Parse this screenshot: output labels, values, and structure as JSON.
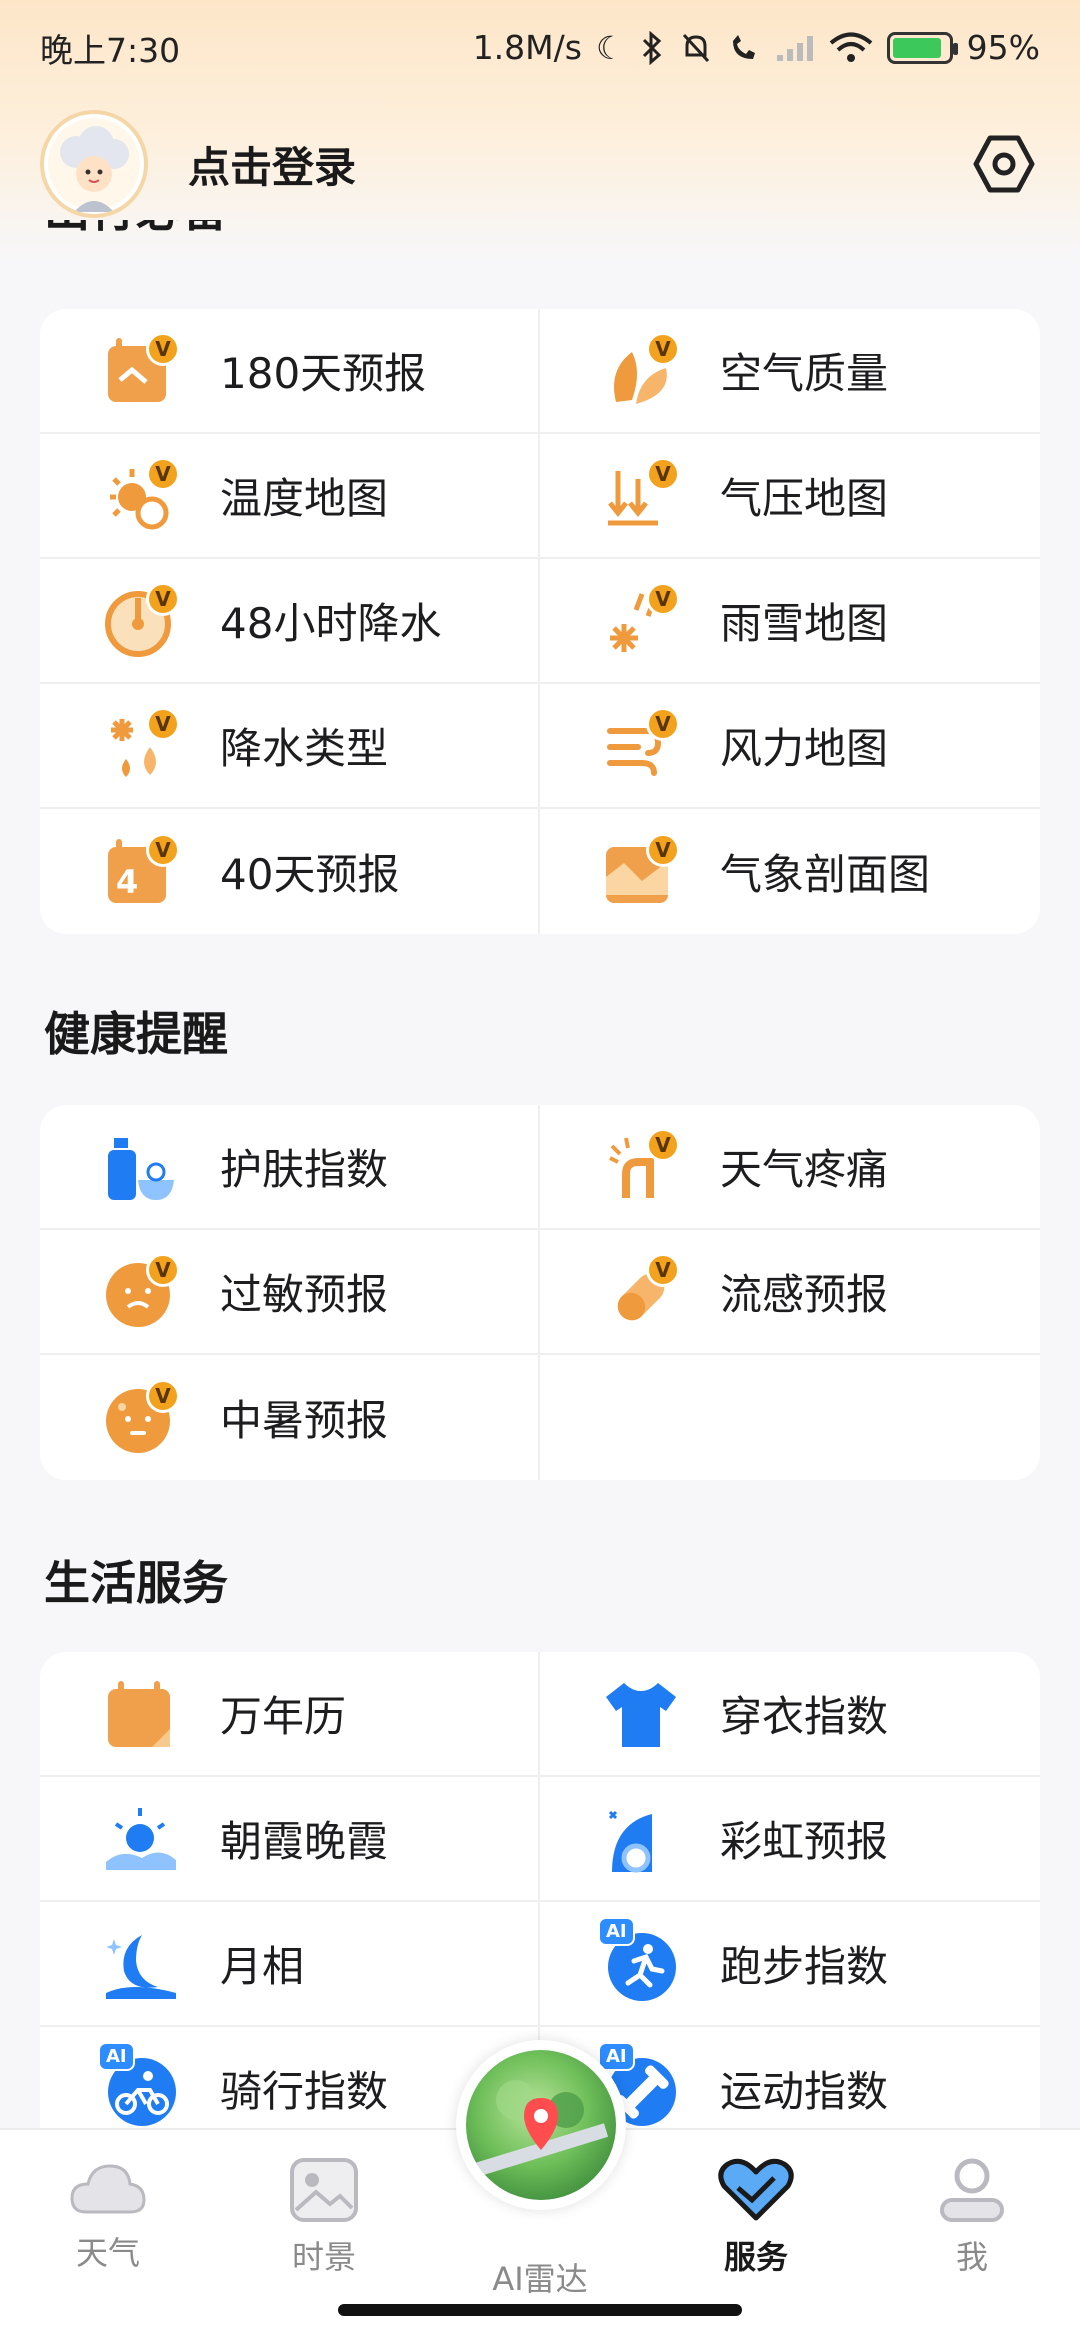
{
  "status_bar": {
    "time": "晚上7:30",
    "net_speed": "1.8M/s",
    "battery": "95%"
  },
  "header": {
    "login_label": "点击登录"
  },
  "sections": {
    "travel": {
      "title": "出行必备",
      "items": [
        {
          "label": "180天预报",
          "icon": "calendar-180-icon",
          "vip": true
        },
        {
          "label": "空气质量",
          "icon": "leaf-icon",
          "vip": true
        },
        {
          "label": "温度地图",
          "icon": "temperature-map-icon",
          "vip": true
        },
        {
          "label": "气压地图",
          "icon": "pressure-map-icon",
          "vip": true
        },
        {
          "label": "48小时降水",
          "icon": "precipitation-48h-icon",
          "vip": true
        },
        {
          "label": "雨雪地图",
          "icon": "rain-snow-map-icon",
          "vip": true
        },
        {
          "label": "降水类型",
          "icon": "precipitation-type-icon",
          "vip": true
        },
        {
          "label": "风力地图",
          "icon": "wind-map-icon",
          "vip": true
        },
        {
          "label": "40天预报",
          "icon": "calendar-40-icon",
          "vip": true
        },
        {
          "label": "气象剖面图",
          "icon": "weather-profile-icon",
          "vip": true
        }
      ]
    },
    "health": {
      "title": "健康提醒",
      "items": [
        {
          "label": "护肤指数",
          "icon": "skincare-icon",
          "vip": false
        },
        {
          "label": "天气疼痛",
          "icon": "joint-pain-icon",
          "vip": true
        },
        {
          "label": "过敏预报",
          "icon": "allergy-icon",
          "vip": true
        },
        {
          "label": "流感预报",
          "icon": "flu-pill-icon",
          "vip": true
        },
        {
          "label": "中暑预报",
          "icon": "heatstroke-icon",
          "vip": true
        }
      ]
    },
    "life": {
      "title": "生活服务",
      "items": [
        {
          "label": "万年历",
          "icon": "calendar-icon",
          "ai": false
        },
        {
          "label": "穿衣指数",
          "icon": "tshirt-icon",
          "ai": false
        },
        {
          "label": "朝霞晚霞",
          "icon": "sunrise-icon",
          "ai": false
        },
        {
          "label": "彩虹预报",
          "icon": "rainbow-icon",
          "ai": false
        },
        {
          "label": "月相",
          "icon": "moon-icon",
          "ai": false
        },
        {
          "label": "跑步指数",
          "icon": "running-icon",
          "ai": true
        },
        {
          "label": "骑行指数",
          "icon": "cycling-icon",
          "ai": true
        },
        {
          "label": "运动指数",
          "icon": "sport-icon",
          "ai": true
        }
      ]
    }
  },
  "badges": {
    "vip": "V",
    "ai": "AI"
  },
  "nav": {
    "weather": "天气",
    "scenery": "时景",
    "radar": "AI雷达",
    "service": "服务",
    "me": "我"
  },
  "colors": {
    "accent_orange": "#f3a21d",
    "icon_orange": "#ef9a3d",
    "icon_blue": "#1f7cf2"
  }
}
